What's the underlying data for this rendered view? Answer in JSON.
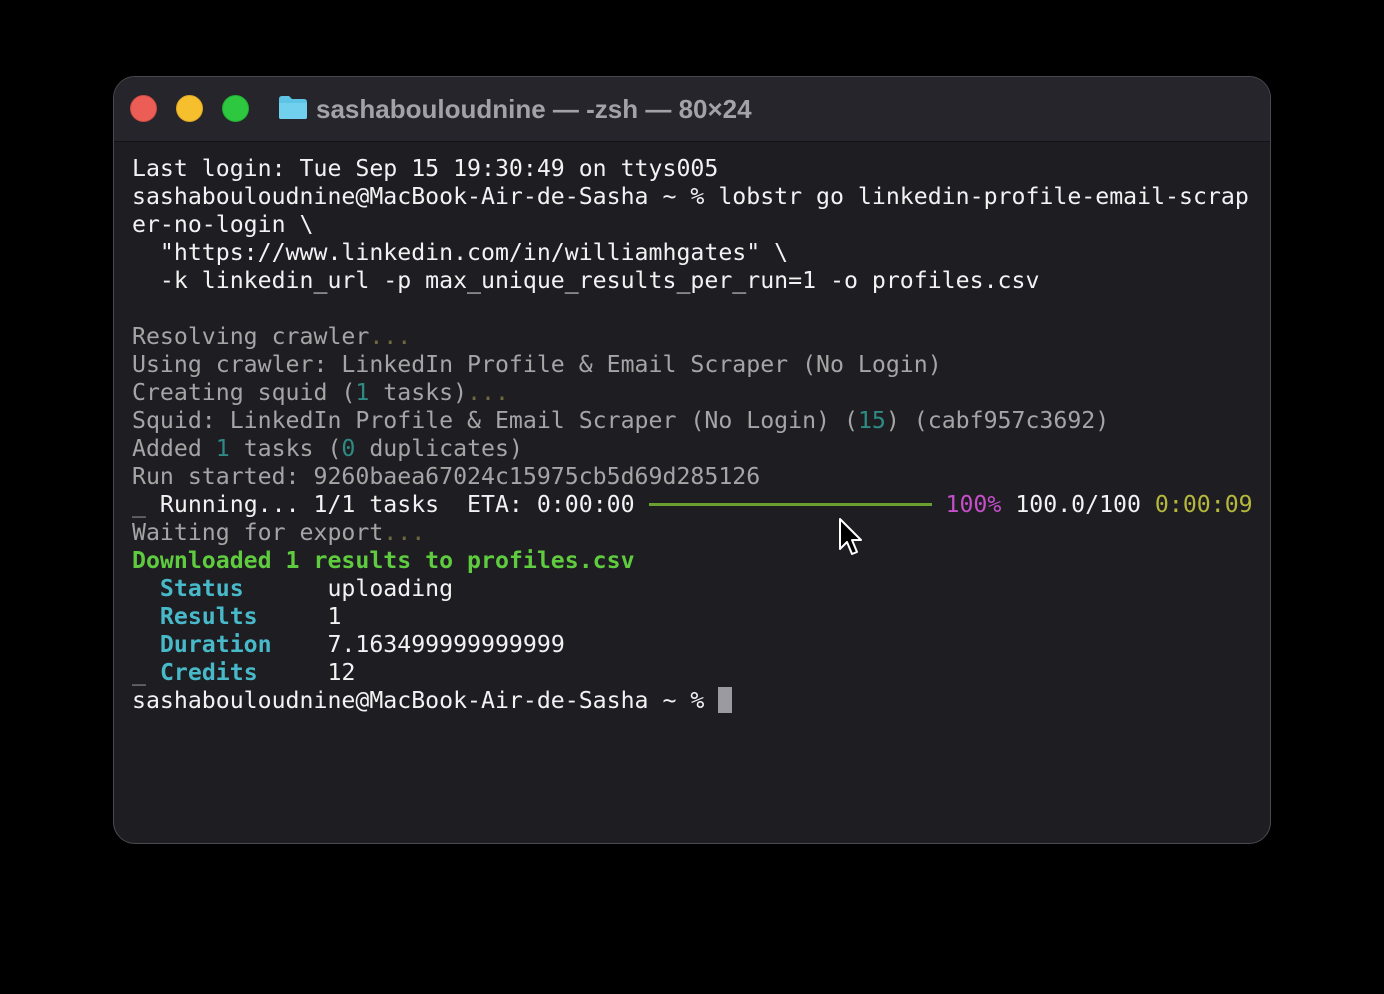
{
  "window": {
    "title": "sashabouloudnine — -zsh — 80×24"
  },
  "terminal": {
    "last_login": "Last login: Tue Sep 15 19:30:49 on ttys005",
    "command_line_1": "sashabouloudnine@MacBook-Air-de-Sasha ~ % lobstr go linkedin-profile-email-scrap",
    "command_line_2": "er-no-login \\",
    "command_line_3": "  \"https://www.linkedin.com/in/williamhgates\" \\",
    "command_line_4": "  -k linkedin_url -p max_unique_results_per_run=1 -o profiles.csv",
    "resolving": "Resolving crawler",
    "ellipsis": "...",
    "using_crawler": "Using crawler: LinkedIn Profile & Email Scraper (No Login)",
    "creating_pre": "Creating squid (",
    "creating_num": "1",
    "creating_post": " tasks)",
    "squid_pre": "Squid: LinkedIn Profile & Email Scraper (No Login) (",
    "squid_num": "15",
    "squid_post": ") (cabf957c3692)",
    "added_pre": "Added ",
    "added_num": "1",
    "added_mid": " tasks (",
    "added_dup": "0",
    "added_post": " duplicates)",
    "run_started": "Run started: 9260baea67024c15975cb5d69d285126",
    "running_marker": "_",
    "running_text": " Running... 1/1 tasks  ETA: 0:00:00 ",
    "progress_fraction": 1.0,
    "progress_percent": "100%",
    "progress_count": "100.0/100",
    "elapsed": "0:00:09",
    "waiting": "Waiting for export",
    "downloaded": "Downloaded 1 results to profiles.csv",
    "status_key": "Status",
    "status_value": "uploading",
    "results_key": "Results",
    "results_value": "1",
    "duration_key": "Duration",
    "duration_value": "7.163499999999999",
    "credits_marker": "_",
    "credits_key": "Credits",
    "credits_value": "12",
    "prompt": "sashabouloudnine@MacBook-Air-de-Sasha ~ % "
  },
  "colors": {
    "red_light": "#ec5e55",
    "yellow_light": "#f5bf2e",
    "green_light": "#2dc83f",
    "folder": "#5ec4e6",
    "success": "#5fcb3f",
    "key": "#47b9c9",
    "percent": "#c54ec9",
    "elapsed": "#b6b83b",
    "bar": "#6aa030"
  },
  "icons": {
    "close": "close-light",
    "minimize": "minimize-light",
    "zoom": "zoom-light",
    "folder": "folder-icon",
    "pointer": "mouse-pointer-icon"
  }
}
